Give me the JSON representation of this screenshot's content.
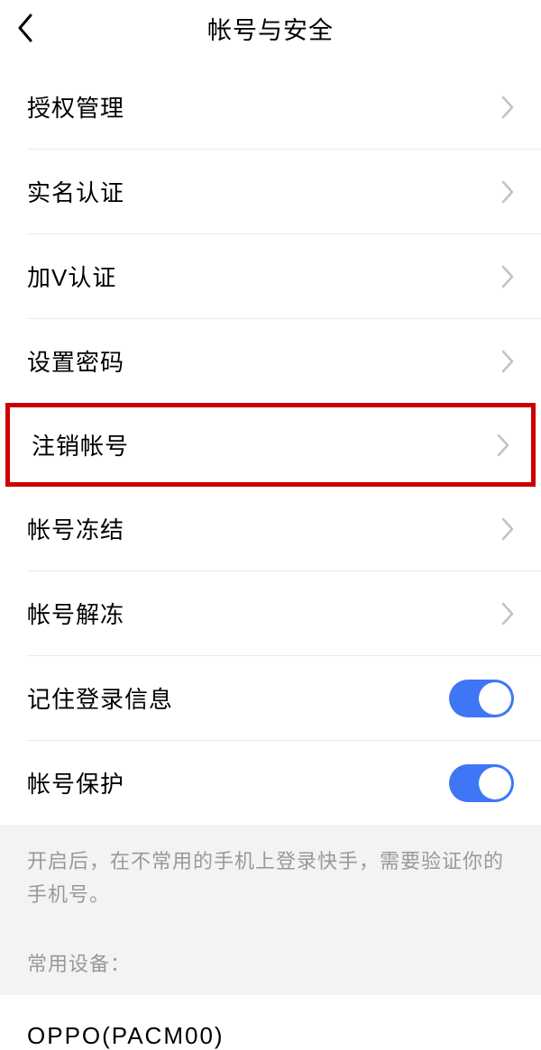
{
  "header": {
    "title": "帐号与安全"
  },
  "items": [
    {
      "label": "授权管理",
      "type": "chevron"
    },
    {
      "label": "实名认证",
      "type": "chevron"
    },
    {
      "label": "加V认证",
      "type": "chevron"
    },
    {
      "label": "设置密码",
      "type": "chevron"
    },
    {
      "label": "注销帐号",
      "type": "chevron",
      "highlighted": true
    },
    {
      "label": "帐号冻结",
      "type": "chevron"
    },
    {
      "label": "帐号解冻",
      "type": "chevron"
    },
    {
      "label": "记住登录信息",
      "type": "toggle",
      "value": true
    },
    {
      "label": "帐号保护",
      "type": "toggle",
      "value": true
    }
  ],
  "footer": {
    "hint": "开启后，在不常用的手机上登录快手，需要验证你的手机号。",
    "devices_label": "常用设备："
  },
  "device": {
    "name": "OPPO(PACM00)"
  },
  "colors": {
    "highlight_border": "#cc0000",
    "toggle_on": "#3e76f6"
  }
}
